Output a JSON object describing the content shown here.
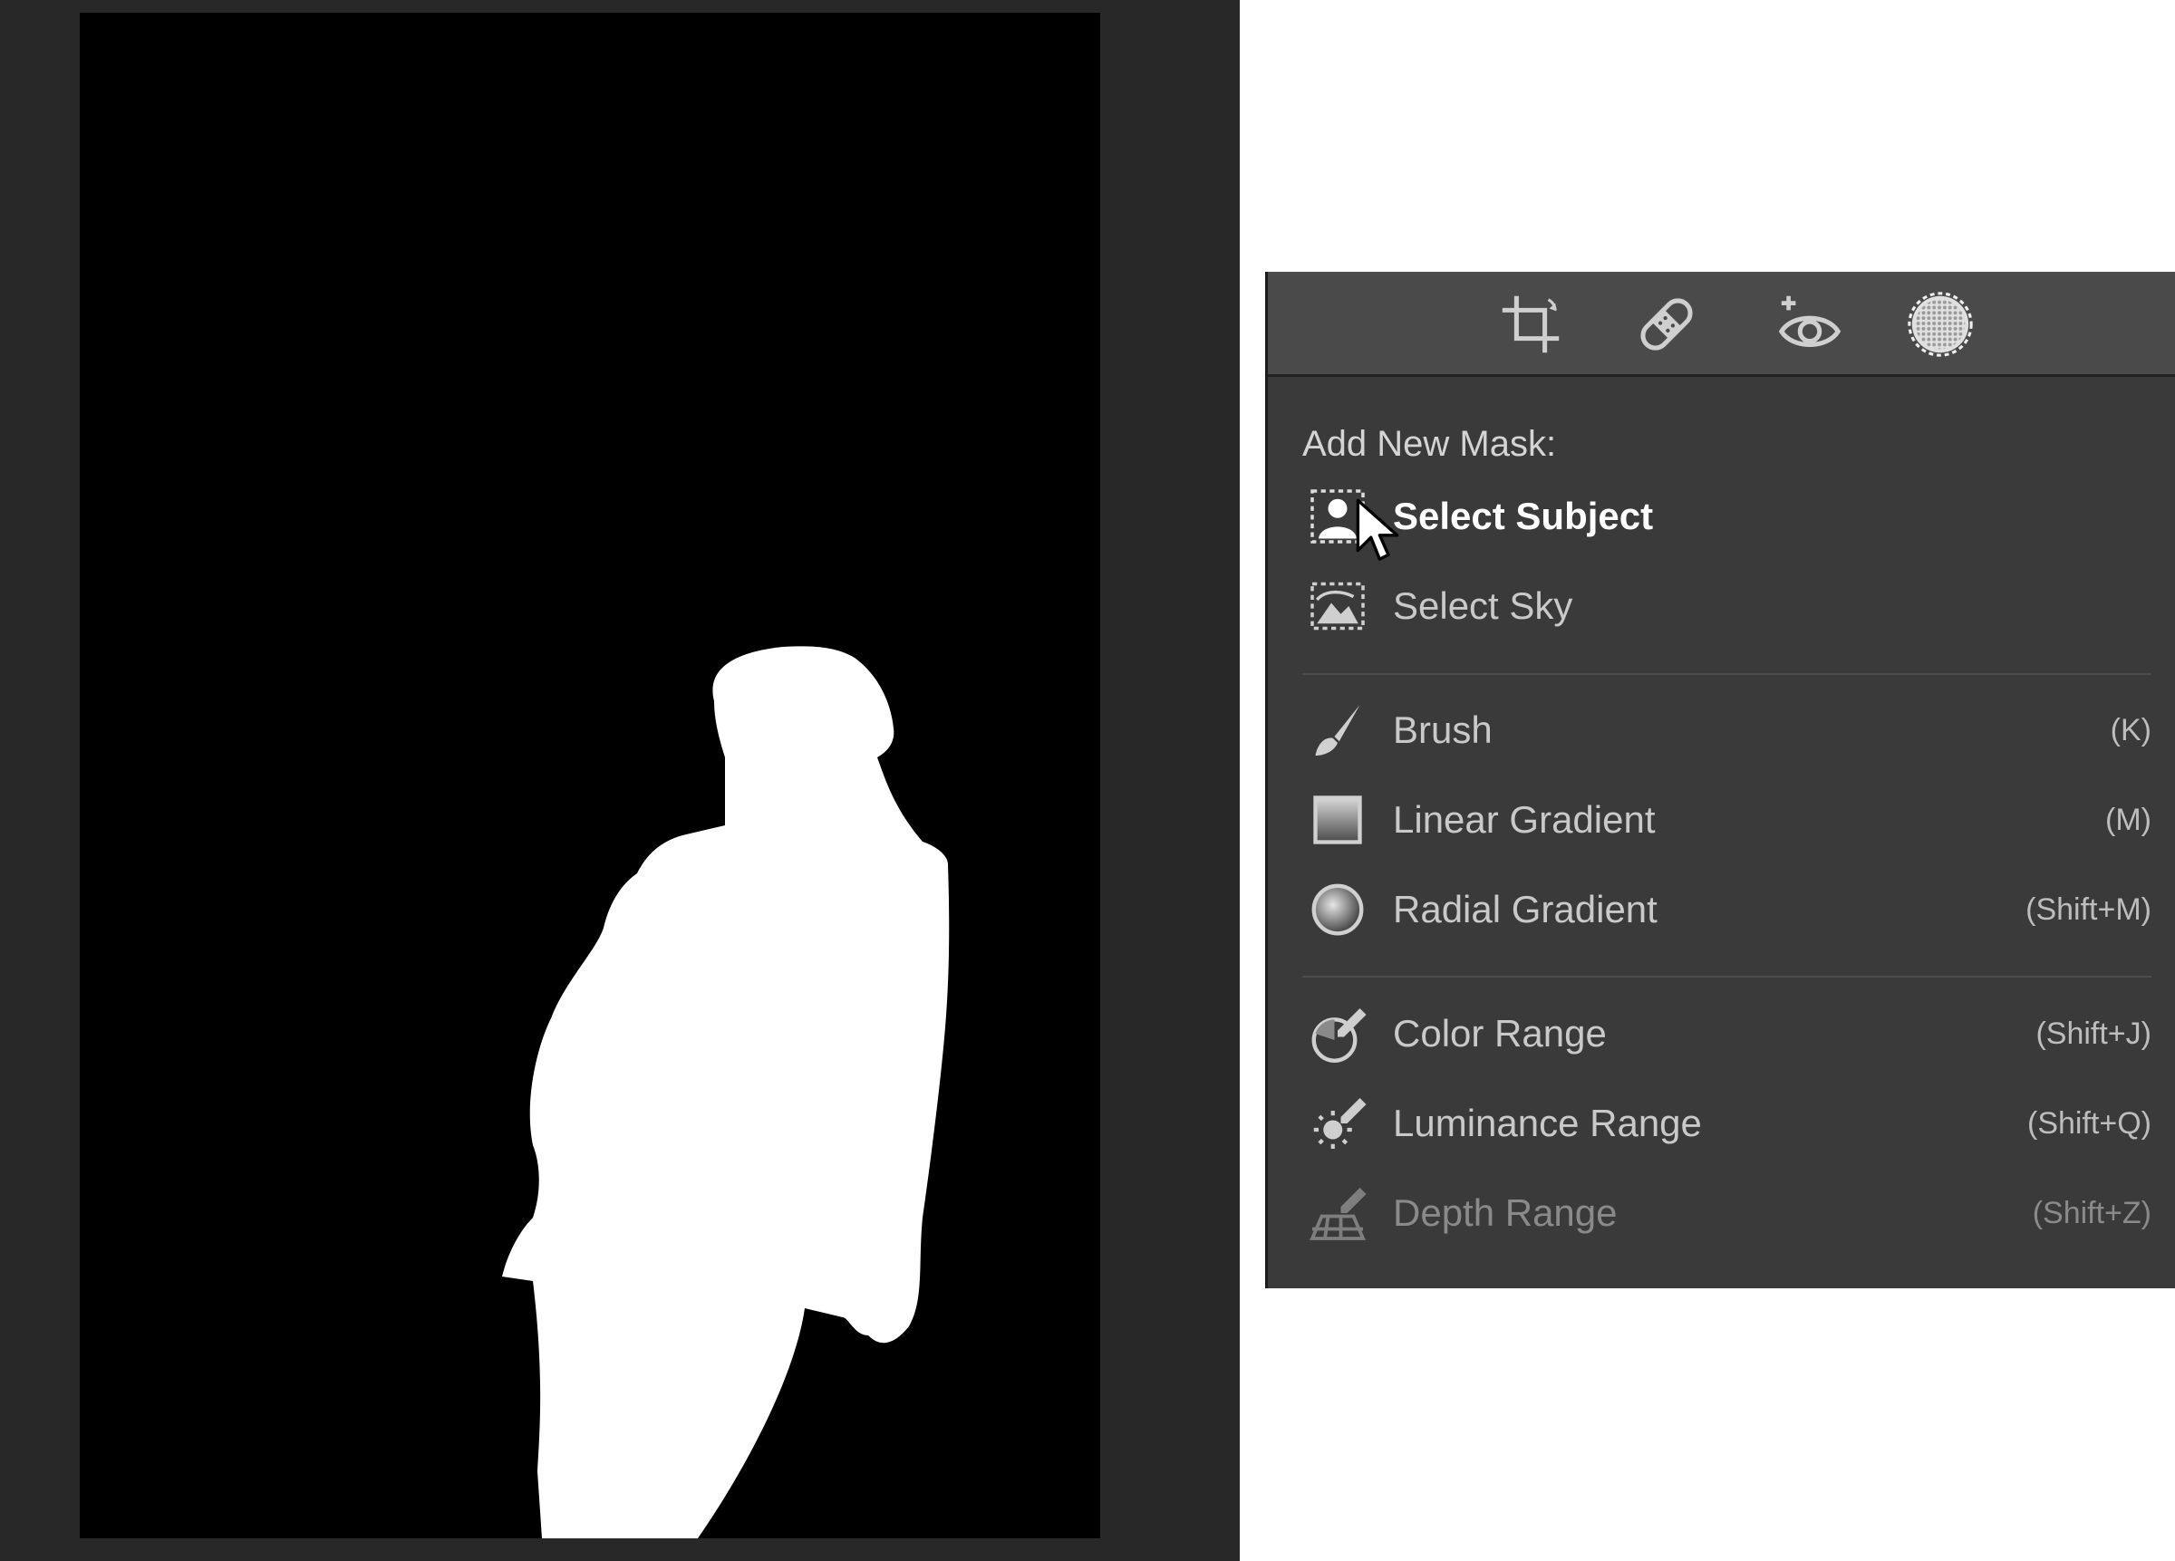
{
  "colors": {
    "canvas_bg": "#282828",
    "mask_background": "#000000",
    "mask_subject": "#ffffff",
    "panel_bg": "#3a3a3a",
    "toolstrip_bg": "#4a4a4a"
  },
  "toolbar": {
    "tools": [
      {
        "icon": "crop-icon"
      },
      {
        "icon": "healing-bandage-icon"
      },
      {
        "icon": "red-eye-icon"
      },
      {
        "icon": "masking-icon",
        "active": true
      }
    ]
  },
  "mask_menu": {
    "heading": "Add New Mask:",
    "groups": [
      {
        "items": [
          {
            "label": "Select Subject",
            "shortcut": "",
            "icon": "select-subject-icon",
            "state": "hovered"
          },
          {
            "label": "Select Sky",
            "shortcut": "",
            "icon": "select-sky-icon",
            "state": "normal"
          }
        ]
      },
      {
        "items": [
          {
            "label": "Brush",
            "shortcut": "(K)",
            "icon": "brush-icon",
            "state": "normal"
          },
          {
            "label": "Linear Gradient",
            "shortcut": "(M)",
            "icon": "linear-gradient-icon",
            "state": "normal"
          },
          {
            "label": "Radial Gradient",
            "shortcut": "(Shift+M)",
            "icon": "radial-gradient-icon",
            "state": "normal"
          }
        ]
      },
      {
        "items": [
          {
            "label": "Color Range",
            "shortcut": "(Shift+J)",
            "icon": "color-range-icon",
            "state": "normal"
          },
          {
            "label": "Luminance Range",
            "shortcut": "(Shift+Q)",
            "icon": "luminance-range-icon",
            "state": "normal"
          },
          {
            "label": "Depth Range",
            "shortcut": "(Shift+Z)",
            "icon": "depth-range-icon",
            "state": "disabled"
          }
        ]
      }
    ]
  }
}
